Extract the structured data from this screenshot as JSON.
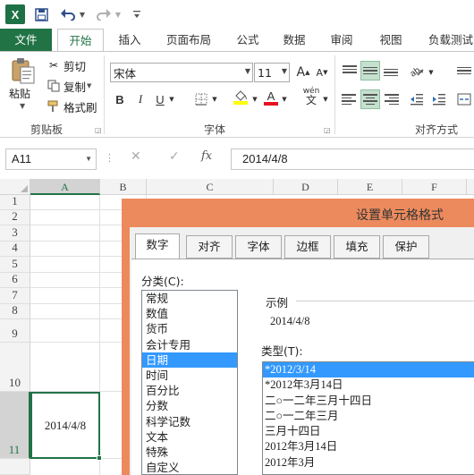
{
  "qat": {
    "app_icon": "X",
    "save_icon": "save-icon",
    "undo_icon": "undo-icon",
    "redo_icon": "redo-icon"
  },
  "tabs": [
    "文件",
    "开始",
    "插入",
    "页面布局",
    "公式",
    "数据",
    "审阅",
    "视图",
    "负载测试"
  ],
  "ribbon": {
    "clipboard": {
      "paste": "粘贴",
      "cut": "剪切",
      "copy": "复制",
      "format_painter": "格式刷",
      "group_label": "剪贴板"
    },
    "font": {
      "font_name": "宋体",
      "font_size": "11",
      "grow": "A",
      "shrink": "A",
      "bold": "B",
      "italic": "I",
      "underline": "U",
      "wen": "wén",
      "font_color_glyph": "A",
      "fill_color": "#ffff00",
      "font_color": "#e81123",
      "group_label": "字体"
    },
    "alignment": {
      "group_label": "对齐方式"
    }
  },
  "formula_bar": {
    "name_box": "A11",
    "fx": "fx",
    "value": "2014/4/8"
  },
  "grid": {
    "columns": [
      "A",
      "B",
      "C",
      "D",
      "E",
      "F"
    ],
    "rows": [
      "1",
      "2",
      "3",
      "4",
      "5",
      "6",
      "7",
      "8",
      "9",
      "10",
      "11"
    ],
    "active_cell_value": "2014/4/8"
  },
  "dialog": {
    "title": "设置单元格格式",
    "tabs": [
      "数字",
      "对齐",
      "字体",
      "边框",
      "填充",
      "保护"
    ],
    "category_label": "分类(C):",
    "categories": [
      "常规",
      "数值",
      "货币",
      "会计专用",
      "日期",
      "时间",
      "百分比",
      "分数",
      "科学记数",
      "文本",
      "特殊",
      "自定义"
    ],
    "selected_category": "日期",
    "sample_label": "示例",
    "sample_value": "2014/4/8",
    "type_label": "类型(T):",
    "types": [
      "*2012/3/14",
      "*2012年3月14日",
      "二○一二年三月十四日",
      "二○一二年三月",
      "三月十四日",
      "2012年3月14日",
      "2012年3月"
    ],
    "selected_type": "*2012/3/14"
  }
}
